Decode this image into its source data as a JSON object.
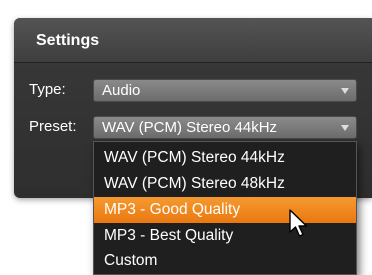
{
  "window": {
    "title": "Settings"
  },
  "type_field": {
    "label": "Type:",
    "value": "Audio"
  },
  "preset_field": {
    "label": "Preset:",
    "value": "WAV (PCM) Stereo 44kHz",
    "options": [
      "WAV (PCM) Stereo 44kHz",
      "WAV (PCM) Stereo 48kHz",
      "MP3 - Good Quality",
      "MP3 - Best Quality",
      "Custom"
    ],
    "highlighted_option": "MP3 - Good Quality"
  },
  "colors": {
    "highlight": "#f08a20",
    "panel_bg": "#333333"
  },
  "icons": {
    "dropdown_arrow": "chevron-down-icon",
    "pointer": "mouse-cursor-icon"
  }
}
